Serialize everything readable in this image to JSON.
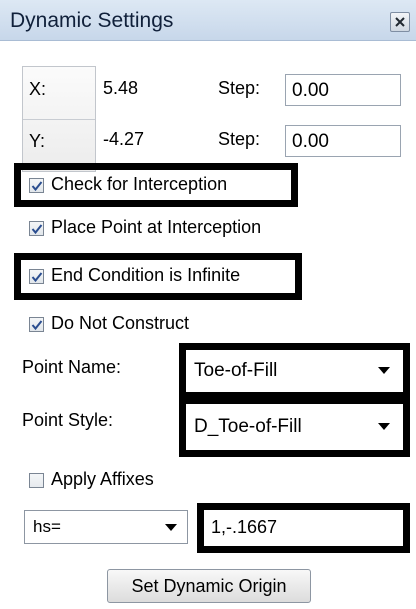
{
  "window": {
    "title": "Dynamic Settings",
    "close_icon": "close-icon"
  },
  "coords": {
    "x_label": "X:",
    "x_value": "5.48",
    "x_step_label": "Step:",
    "x_step_value": "0.00",
    "y_label": "Y:",
    "y_value": "-4.27",
    "y_step_label": "Step:",
    "y_step_value": "0.00"
  },
  "options": [
    {
      "label": "Check for Interception",
      "checked": true
    },
    {
      "label": "Place Point at Interception",
      "checked": true
    },
    {
      "label": "End Condition is Infinite",
      "checked": true
    },
    {
      "label": "Do Not Construct",
      "checked": true
    }
  ],
  "point_name": {
    "label": "Point Name:",
    "value": "Toe-of-Fill"
  },
  "point_style": {
    "label": "Point Style:",
    "value": "D_Toe-of-Fill"
  },
  "affixes": {
    "label": "Apply Affixes",
    "checked": false
  },
  "mode_select": {
    "value": "hs="
  },
  "value_field": {
    "value": "1,-.1667"
  },
  "origin_button": {
    "label": "Set Dynamic Origin"
  }
}
